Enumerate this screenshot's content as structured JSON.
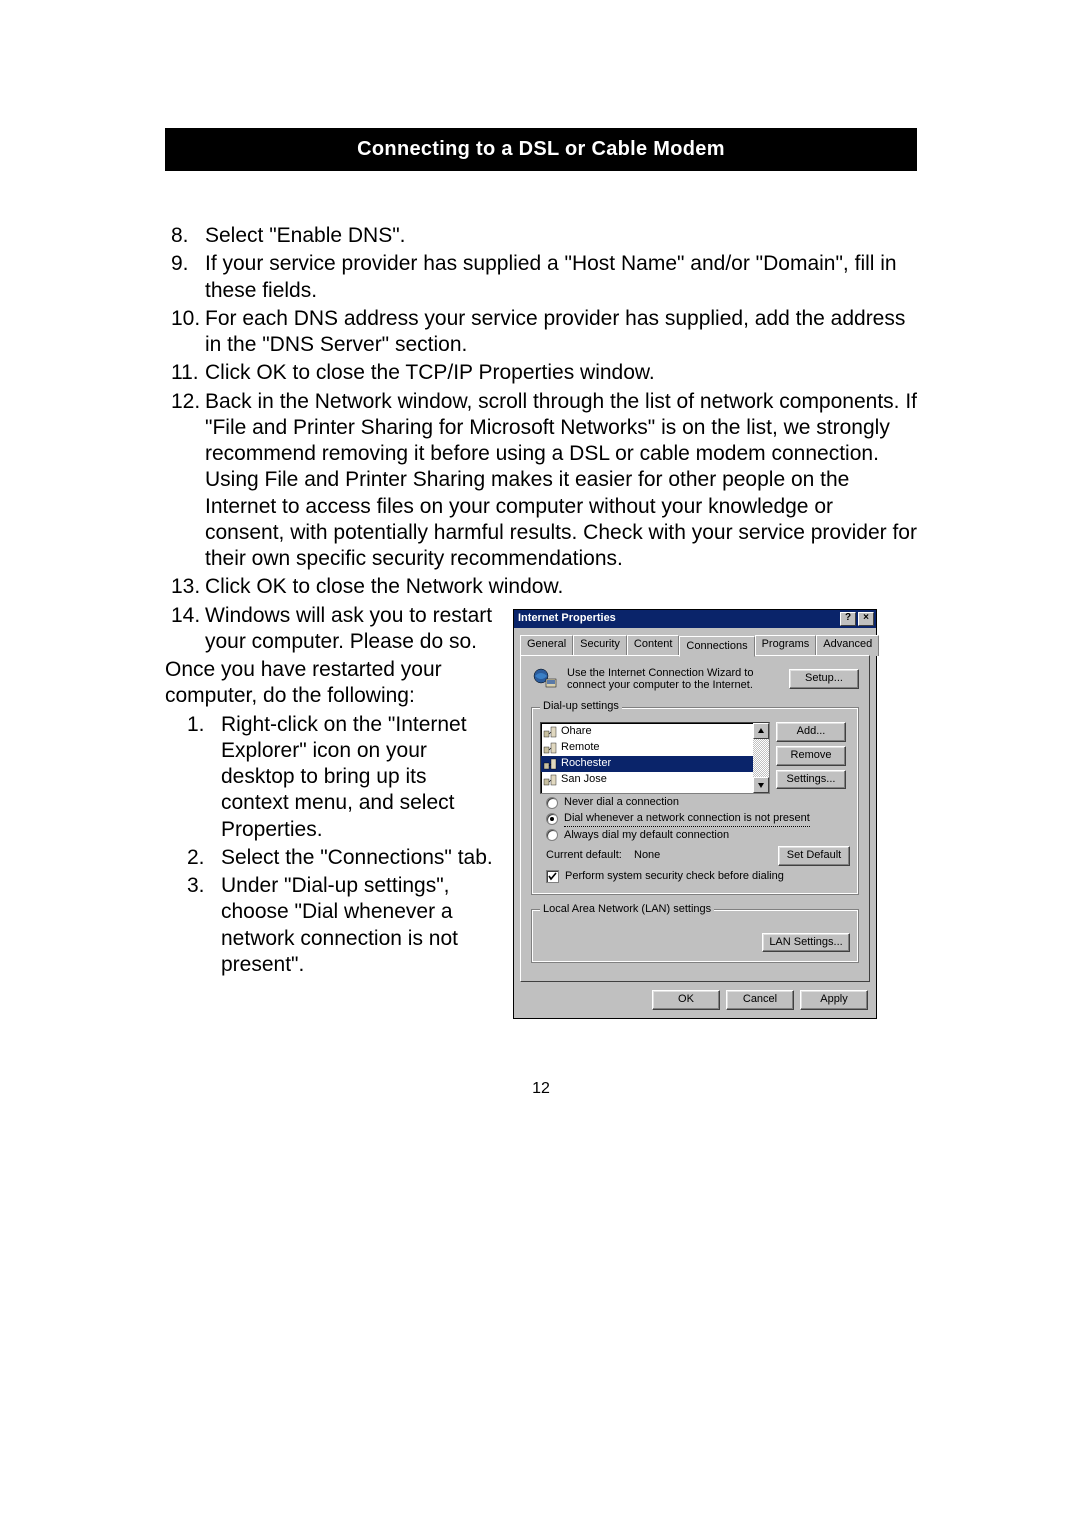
{
  "header": {
    "title": "Connecting to a DSL or Cable Modem"
  },
  "steps_a": [
    {
      "n": "8.",
      "t": "Select \"Enable DNS\"."
    },
    {
      "n": "9.",
      "t": "If your service provider has supplied a \"Host Name\" and/or \"Domain\", fill in these fields."
    },
    {
      "n": "10.",
      "t": "For each DNS address your service provider has supplied, add the address in the \"DNS Server\" section."
    },
    {
      "n": "11.",
      "t": "Click OK to close the TCP/IP Properties window."
    },
    {
      "n": "12.",
      "t": "Back in the Network window, scroll through the list of network components. If \"File and Printer Sharing for Microsoft Networks\" is on the list, we strongly recommend removing it before using a DSL or cable modem connection. Using File and Printer Sharing makes it easier for other people on the Internet to access files on your computer without your knowledge or consent, with potentially harmful results. Check with your service provider for their own specific security recommendations."
    },
    {
      "n": "13.",
      "t": "Click OK to close the Network window."
    }
  ],
  "step14": {
    "n": "14.",
    "t": "Windows will ask you to restart your computer. Please do so."
  },
  "after_restart": "Once you have restarted your computer, do the following:",
  "steps_b": [
    {
      "n": "1.",
      "t": "Right-click on the \"Internet Explorer\" icon on your desktop to bring up its context menu, and select Properties."
    },
    {
      "n": "2.",
      "t": "Select the \"Connections\" tab."
    },
    {
      "n": "3.",
      "t": "Under \"Dial-up settings\", choose \"Dial whenever a network connection is not present\"."
    }
  ],
  "page_number": "12",
  "dialog": {
    "title": "Internet Properties",
    "help": "?",
    "close": "×",
    "tabs": [
      "General",
      "Security",
      "Content",
      "Connections",
      "Programs",
      "Advanced"
    ],
    "active_tab": "Connections",
    "wizard_text": "Use the Internet Connection Wizard to connect your computer to the Internet.",
    "setup_btn": "Setup...",
    "dialup_legend": "Dial-up settings",
    "connections": [
      "Ohare",
      "Remote",
      "Rochester",
      "San Jose"
    ],
    "selected_connection": "Rochester",
    "add_btn": "Add...",
    "remove_btn": "Remove",
    "settings_btn": "Settings...",
    "radio_never": "Never dial a connection",
    "radio_whenever": "Dial whenever a network connection is not present",
    "radio_always": "Always dial my default connection",
    "current_default_label": "Current default:",
    "current_default_value": "None",
    "set_default_btn": "Set Default",
    "perform_check": "Perform system security check before dialing",
    "lan_legend": "Local Area Network (LAN) settings",
    "lan_btn": "LAN Settings...",
    "ok_btn": "OK",
    "cancel_btn": "Cancel",
    "apply_btn": "Apply"
  }
}
